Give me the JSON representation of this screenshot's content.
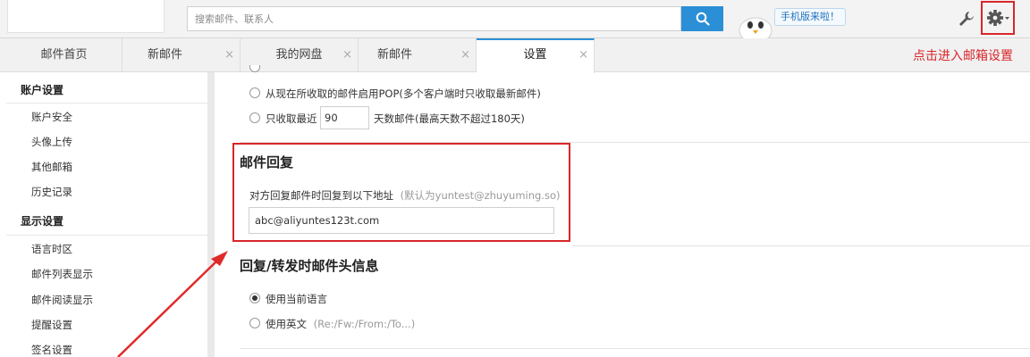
{
  "search": {
    "placeholder": "搜索邮件、联系人"
  },
  "header": {
    "mobile_badge": "手机版来啦！"
  },
  "tabs": [
    {
      "label": "邮件首页",
      "closable": false
    },
    {
      "label": "新邮件",
      "closable": true
    },
    {
      "label": "我的网盘",
      "closable": true
    },
    {
      "label": "新邮件",
      "closable": true
    },
    {
      "label": "设置",
      "closable": true,
      "active": true
    }
  ],
  "annotation": {
    "text": "点击进入邮箱设置",
    "color": "#d9262a"
  },
  "sidebar": {
    "sections": [
      {
        "heading": "账户设置",
        "items": [
          "账户安全",
          "头像上传",
          "其他邮箱",
          "历史记录"
        ]
      },
      {
        "heading": "显示设置",
        "items": [
          "语言时区",
          "邮件列表显示",
          "邮件阅读显示",
          "提醒设置",
          "签名设置"
        ]
      }
    ]
  },
  "pop": {
    "option_all": "从现在所收取的邮件启用POP(多个客户端时只收取最新邮件)",
    "option_recent_prefix": "只收取最近",
    "recent_days": "90",
    "option_recent_suffix": "天数邮件(最高天数不超过180天)"
  },
  "reply": {
    "title": "邮件回复",
    "label": "对方回复邮件时回复到以下地址",
    "hint": "(默认为yuntest@zhuyuming.so)",
    "value": "abc@aliyuntes123t.com"
  },
  "header_info": {
    "title": "回复/转发时邮件头信息",
    "option_current": "使用当前语言",
    "option_english": "使用英文",
    "option_english_hint": "(Re:/Fw:/From:/To...)"
  },
  "colors": {
    "accent": "#2a8fd6",
    "annotation_red": "#d9262a"
  }
}
